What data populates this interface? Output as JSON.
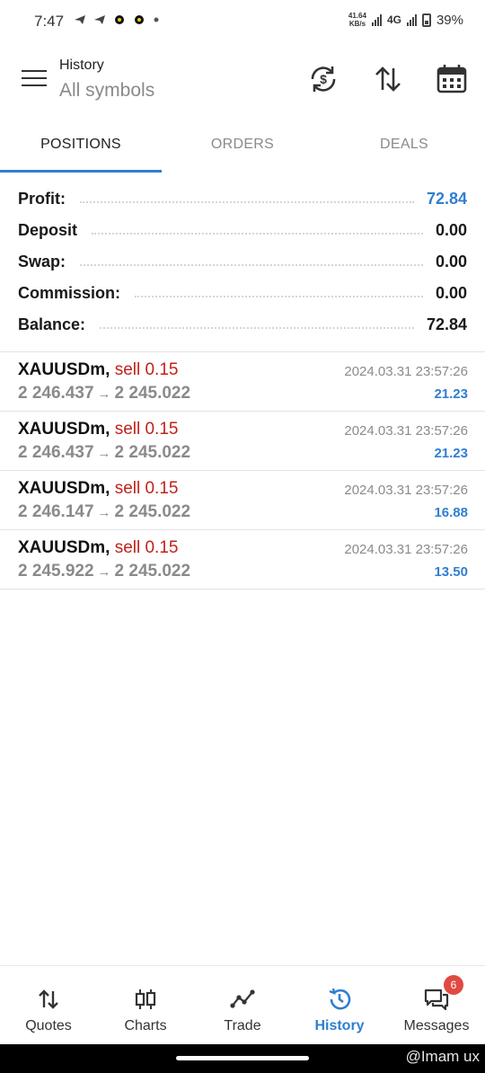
{
  "status_bar": {
    "time": "7:47",
    "speed_value": "41.64",
    "speed_unit": "KB/s",
    "network": "4G",
    "battery": "39%"
  },
  "header": {
    "title": "History",
    "subtitle": "All symbols"
  },
  "tabs": [
    {
      "label": "POSITIONS",
      "active": true
    },
    {
      "label": "ORDERS",
      "active": false
    },
    {
      "label": "DEALS",
      "active": false
    }
  ],
  "summary": [
    {
      "label": "Profit:",
      "value": "72.84"
    },
    {
      "label": "Deposit",
      "value": "0.00"
    },
    {
      "label": "Swap:",
      "value": "0.00"
    },
    {
      "label": "Commission:",
      "value": "0.00"
    },
    {
      "label": "Balance:",
      "value": "72.84"
    }
  ],
  "positions": [
    {
      "symbol": "XAUUSDm,",
      "side": "sell 0.15",
      "open": "2 246.437",
      "close": "2 245.022",
      "time": "2024.03.31 23:57:26",
      "profit": "21.23"
    },
    {
      "symbol": "XAUUSDm,",
      "side": "sell 0.15",
      "open": "2 246.437",
      "close": "2 245.022",
      "time": "2024.03.31 23:57:26",
      "profit": "21.23"
    },
    {
      "symbol": "XAUUSDm,",
      "side": "sell 0.15",
      "open": "2 246.147",
      "close": "2 245.022",
      "time": "2024.03.31 23:57:26",
      "profit": "16.88"
    },
    {
      "symbol": "XAUUSDm,",
      "side": "sell 0.15",
      "open": "2 245.922",
      "close": "2 245.022",
      "time": "2024.03.31 23:57:26",
      "profit": "13.50"
    }
  ],
  "arrow": "→",
  "bottom_nav": [
    {
      "label": "Quotes",
      "icon": "quotes-icon"
    },
    {
      "label": "Charts",
      "icon": "charts-icon"
    },
    {
      "label": "Trade",
      "icon": "trade-icon"
    },
    {
      "label": "History",
      "icon": "history-icon",
      "active": true
    },
    {
      "label": "Messages",
      "icon": "messages-icon",
      "badge": "6"
    }
  ],
  "watermark": "@Imam ux",
  "colors": {
    "accent": "#2f7fd1",
    "sell": "#c0221b",
    "badge": "#e04a43"
  }
}
